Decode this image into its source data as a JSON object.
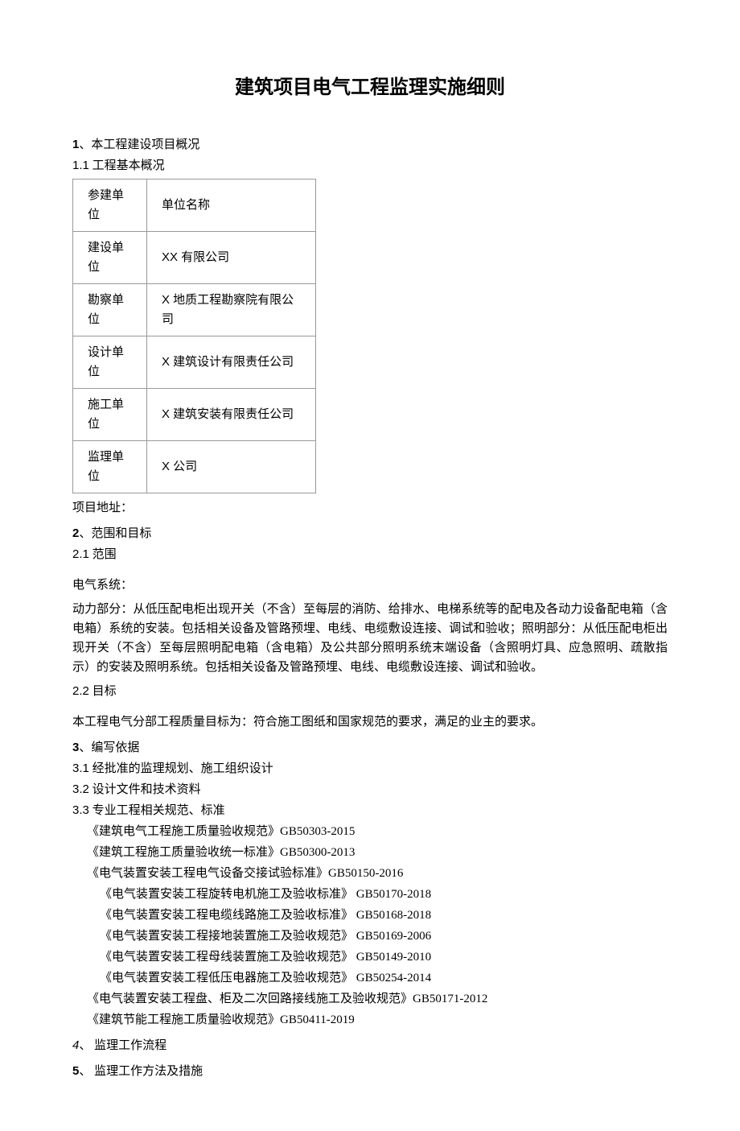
{
  "title": "建筑项目电气工程监理实施细则",
  "sec1": {
    "num": "1",
    "head": "、本工程建设项目概况",
    "sub1_n": "1.1",
    "sub1_t": " 工程基本概况",
    "table": {
      "r0c0": "参建单位",
      "r0c1": "单位名称",
      "r1c0": "建设单位",
      "r1c1": "XX 有限公司",
      "r2c0": "勘察单位",
      "r2c1": "X 地质工程勘察院有限公司",
      "r3c0": "设计单位",
      "r3c1": "X 建筑设计有限责任公司",
      "r4c0": "施工单位",
      "r4c1": "X 建筑安装有限责任公司",
      "r5c0": "监理单位",
      "r5c1": "X 公司"
    },
    "addr": "项目地址："
  },
  "sec2": {
    "num": "2",
    "head": "、范围和目标",
    "s21_n": "2.1",
    "s21_t": "   范围",
    "sys": "电气系统：",
    "body": "动力部分：从低压配电柜出现开关（不含）至每层的消防、给排水、电梯系统等的配电及各动力设备配电箱（含电箱）系统的安装。包括相关设备及管路预埋、电线、电缆敷设连接、调试和验收；照明部分：从低压配电柜出现开关（不含）至每层照明配电箱（含电箱）及公共部分照明系统末端设备（含照明灯具、应急照明、疏散指示）的安装及照明系统。包括相关设备及管路预埋、电线、电缆敷设连接、调试和验收。",
    "s22_n": "2.2",
    "s22_t": "   目标",
    "goal": "本工程电气分部工程质量目标为：符合施工图纸和国家规范的要求，满足的业主的要求。"
  },
  "sec3": {
    "num": "3",
    "head": "、编写依据",
    "i1_n": "3.1",
    "i1_t": "   经批准的监理规划、施工组织设计",
    "i2_n": "3.2",
    "i2_t": "   设计文件和技术资料",
    "i3_n": "3.3",
    "i3_t": "   专业工程相关规范、标准",
    "std": [
      "《建筑电气工程施工质量验收规范》GB50303-2015",
      "《建筑工程施工质量验收统一标准》GB50300-2013",
      "《电气装置安装工程电气设备交接试验标准》GB50150-2016"
    ],
    "std_indent": [
      "《电气装置安装工程旋转电机施工及验收标准》    GB50170-2018",
      "《电气装置安装工程电缆线路施工及验收标准》    GB50168-2018",
      "《电气装置安装工程接地装置施工及验收规范》    GB50169-2006",
      "《电气装置安装工程母线装置施工及验收规范》    GB50149-2010",
      "《电气装置安装工程低压电器施工及验收规范》    GB50254-2014"
    ],
    "std_tail": [
      "《电气装置安装工程盘、柜及二次回路接线施工及验收规范》GB50171-2012",
      "《建筑节能工程施工质量验收规范》GB50411-2019"
    ]
  },
  "sec4": {
    "num": "4",
    "head": "、 监理工作流程"
  },
  "sec5": {
    "num": "5",
    "head": "、 监理工作方法及措施"
  }
}
